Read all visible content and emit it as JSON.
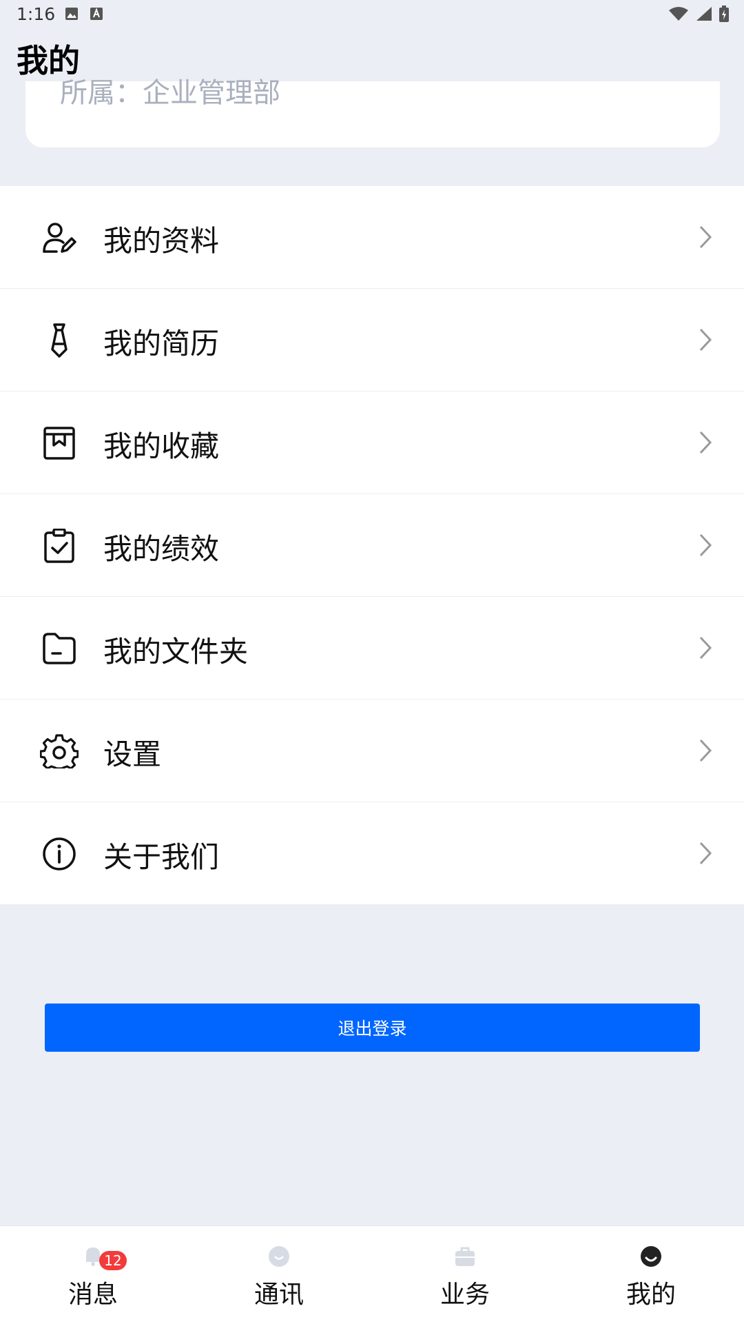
{
  "status_bar": {
    "time": "1:16",
    "left_icons": [
      "image-icon",
      "a-notification-icon"
    ],
    "right_icons": [
      "wifi-icon",
      "signal-icon",
      "battery-icon"
    ]
  },
  "header": {
    "title": "我的"
  },
  "profile": {
    "department": "所属：企业管理部"
  },
  "menu": {
    "items": [
      {
        "label": "我的资料",
        "icon": "user-edit-icon"
      },
      {
        "label": "我的简历",
        "icon": "tie-icon"
      },
      {
        "label": "我的收藏",
        "icon": "favorites-box-icon"
      },
      {
        "label": "我的绩效",
        "icon": "clipboard-check-icon"
      },
      {
        "label": "我的文件夹",
        "icon": "folder-icon"
      },
      {
        "label": "设置",
        "icon": "gear-icon"
      },
      {
        "label": "关于我们",
        "icon": "info-icon"
      }
    ]
  },
  "logout": {
    "label": "退出登录",
    "color": "#0066ff"
  },
  "bottom_nav": {
    "items": [
      {
        "label": "消息",
        "icon": "message-icon",
        "badge": "12"
      },
      {
        "label": "通讯",
        "icon": "contacts-icon"
      },
      {
        "label": "业务",
        "icon": "briefcase-icon"
      },
      {
        "label": "我的",
        "icon": "profile-icon",
        "active": true
      }
    ]
  },
  "colors": {
    "accent": "#0066ff",
    "badge": "#f23b3b",
    "background": "#eceef5"
  }
}
